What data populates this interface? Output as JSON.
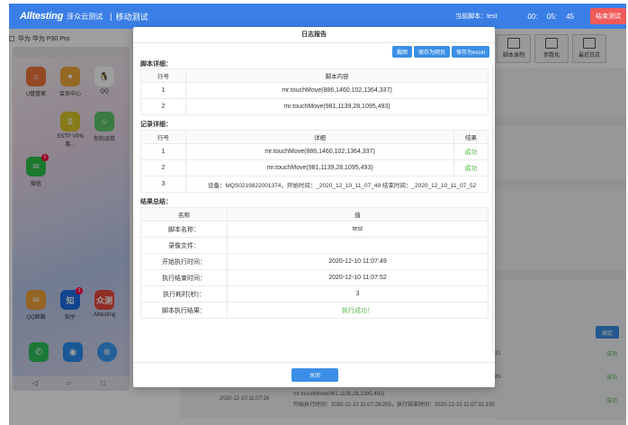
{
  "topbar": {
    "logo": "Alltesting",
    "logo_cn": "泽众云测试",
    "separator": "|",
    "module": "移动测试",
    "current_script": "当前脚本：test",
    "timer": "00: 05: 45",
    "end_button": "结束测试"
  },
  "device": {
    "name": "华为 华为 P30 Pro"
  },
  "phone_apps": [
    {
      "label": "U盘管家",
      "color": "#f0753a",
      "glyph": "⌂"
    },
    {
      "label": "会员中心",
      "color": "#f0a83a",
      "glyph": "♥"
    },
    {
      "label": "QQ",
      "color": "#ffffff",
      "glyph": "🐧"
    },
    {
      "label": "SSTP VPN 客...",
      "color": "#d8c52a",
      "glyph": "S"
    },
    {
      "label": "你的派卷",
      "color": "#5cc96a",
      "glyph": "☺"
    },
    {
      "label": "微信",
      "color": "#2dc24a",
      "glyph": "✉",
      "badge": "6"
    },
    {
      "label": "QQ邮箱",
      "color": "#f0a43a",
      "glyph": "✉"
    },
    {
      "label": "知乎",
      "color": "#1e6fe8",
      "glyph": "知",
      "badge": "3"
    },
    {
      "label": "Alltesting",
      "color": "#e84a3a",
      "glyph": "众测"
    }
  ],
  "toolbar": [
    {
      "label": "脚本录制"
    },
    {
      "label": "参数化"
    },
    {
      "label": "最近日志"
    }
  ],
  "right_panel": {
    "confirm": "确定",
    "success": "成功",
    "num1": "31",
    "num2": "85"
  },
  "bottom_log": {
    "time": "2020-12-10 11:07:26",
    "line1": "mr.touchMove(981,1139,28,1095,493)",
    "line2": "开始执行时间：2020-12-10 11:07:29:255，执行结束时间：2020-12-10 11:07:31:195",
    "status": "成功"
  },
  "modal": {
    "title": "日志报告",
    "buttons": {
      "shot": "截图",
      "save_web": "保存为网页",
      "save_excel": "保存为excel"
    },
    "script_section": "脚本详细：",
    "script_headers": [
      "行号",
      "脚本内容"
    ],
    "script_rows": [
      {
        "no": "1",
        "content": "mr.touchMove(886,1460,102,1364,337)"
      },
      {
        "no": "2",
        "content": "mr.touchMove(981,1139,28,1095,493)"
      }
    ],
    "record_section": "记录详细：",
    "record_headers": [
      "行号",
      "详细",
      "结果"
    ],
    "record_rows": [
      {
        "no": "1",
        "detail": "mr.touchMove(886,1460,102,1364,337)",
        "result": "成功"
      },
      {
        "no": "2",
        "detail": "mr.touchMove(981,1139,28,1095,493)",
        "result": "成功"
      },
      {
        "no": "3",
        "detail": "设备：MQS0219822001374，开始时间：_2020_12_10_11_07_49 结束时间：_2020_12_10_11_07_52",
        "result": ""
      }
    ],
    "summary_section": "结果总结：",
    "summary_headers": [
      "名称",
      "值"
    ],
    "summary_rows": [
      {
        "name": "脚本名称：",
        "value": "test"
      },
      {
        "name": "录像文件：",
        "value": ""
      },
      {
        "name": "开始执行时间：",
        "value": "2020-12-10 11:07:49"
      },
      {
        "name": "执行结束时间：",
        "value": "2020-12-10 11:07:52"
      },
      {
        "name": "执行耗时(秒)：",
        "value": "3"
      },
      {
        "name": "脚本执行结果：",
        "value": "执行成功！"
      }
    ],
    "close": "关闭"
  },
  "colors": {
    "accent": "#3b7fe6",
    "success": "#55b845",
    "danger": "#f05a5a"
  }
}
